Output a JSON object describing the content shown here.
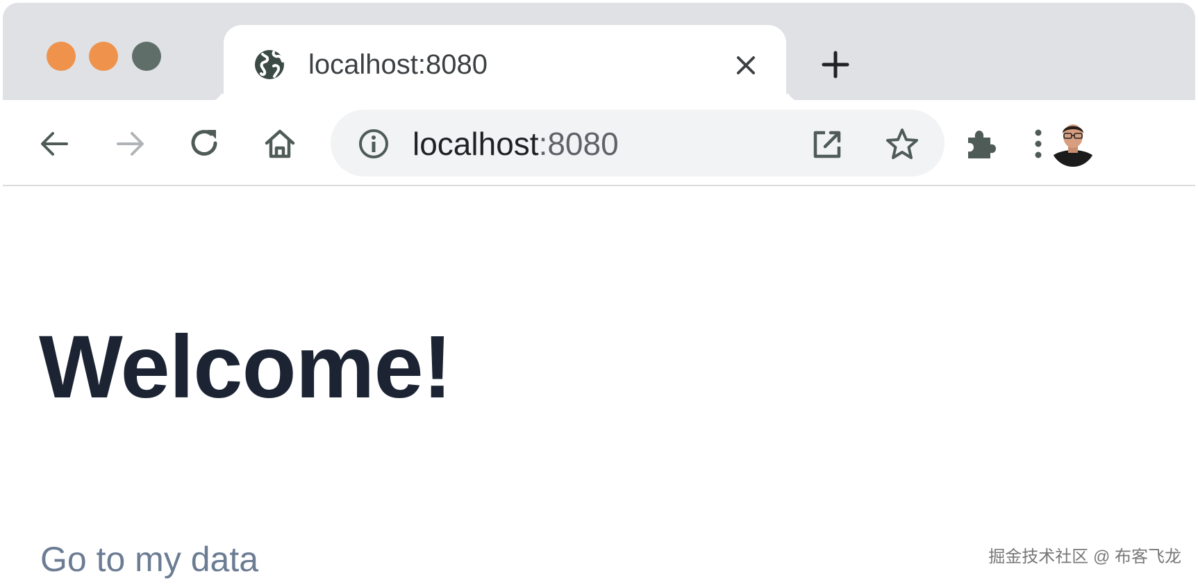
{
  "browser": {
    "traffic_lights": {
      "close_color": "#ef924c",
      "minimize_color": "#ef924c",
      "maximize_color": "#5f6e68"
    },
    "tab": {
      "favicon": "globe-icon",
      "title": "localhost:8080",
      "close_icon": "close-icon"
    },
    "new_tab_icon": "plus-icon",
    "toolbar": {
      "back_icon": "arrow-left-icon",
      "forward_icon": "arrow-right-icon",
      "reload_icon": "reload-icon",
      "home_icon": "home-icon",
      "site_info_icon": "info-icon",
      "url_host": "localhost",
      "url_port": ":8080",
      "open_icon": "open-in-new-icon",
      "bookmark_icon": "star-icon",
      "extensions_icon": "puzzle-icon",
      "profile_icon": "avatar",
      "menu_icon": "more-vertical-icon"
    },
    "colors": {
      "tabstrip": "#dfe1e5",
      "icon": "#4f5b57",
      "icon_disabled": "#b0b4b8",
      "omnibox": "#f1f3f4"
    }
  },
  "page": {
    "heading": "Welcome!",
    "link_label": "Go to my data",
    "heading_color": "#1c2433",
    "link_color": "#6b7c93"
  },
  "watermark": {
    "text": "掘金技术社区 @ 布客飞龙"
  }
}
